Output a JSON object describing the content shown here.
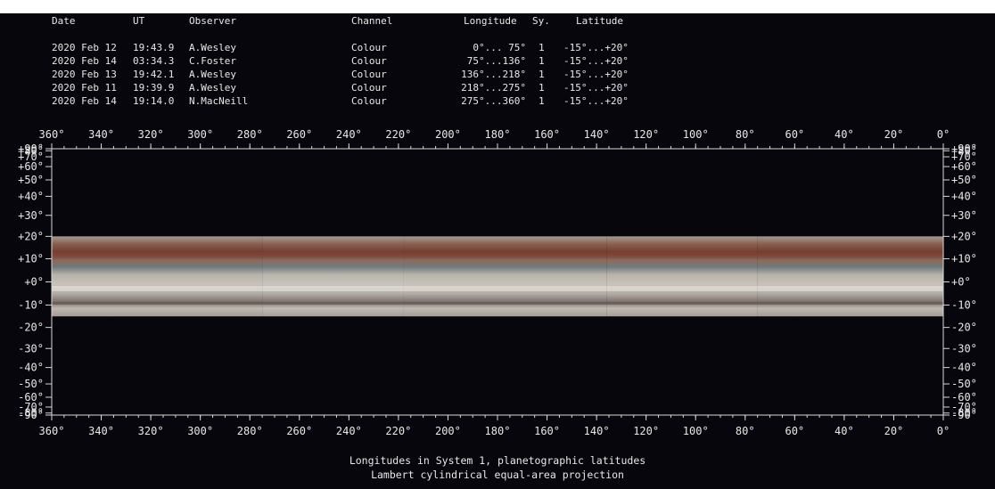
{
  "table": {
    "headers": {
      "date": "Date",
      "ut": "UT",
      "observer": "Observer",
      "channel": "Channel",
      "longitude": "Longitude",
      "system": "Sy.",
      "latitude": "Latitude"
    },
    "rows": [
      {
        "date": "2020 Feb 12",
        "ut": "19:43.9",
        "observer": "A.Wesley",
        "channel": "Colour",
        "longitude": "0°... 75°",
        "system": "1",
        "latitude": "-15°...+20°"
      },
      {
        "date": "2020 Feb 14",
        "ut": "03:34.3",
        "observer": "C.Foster",
        "channel": "Colour",
        "longitude": "75°...136°",
        "system": "1",
        "latitude": "-15°...+20°"
      },
      {
        "date": "2020 Feb 13",
        "ut": "19:42.1",
        "observer": "A.Wesley",
        "channel": "Colour",
        "longitude": "136°...218°",
        "system": "1",
        "latitude": "-15°...+20°"
      },
      {
        "date": "2020 Feb 11",
        "ut": "19:39.9",
        "observer": "A.Wesley",
        "channel": "Colour",
        "longitude": "218°...275°",
        "system": "1",
        "latitude": "-15°...+20°"
      },
      {
        "date": "2020 Feb 14",
        "ut": "19:14.0",
        "observer": "N.MacNeill",
        "channel": "Colour",
        "longitude": "275°...360°",
        "system": "1",
        "latitude": "-15°...+20°"
      }
    ]
  },
  "map": {
    "lon_range": [
      0,
      360
    ],
    "lat_range": [
      -90,
      90
    ],
    "lon_ticks": [
      "360°",
      "340°",
      "320°",
      "300°",
      "280°",
      "260°",
      "240°",
      "220°",
      "200°",
      "180°",
      "160°",
      "140°",
      "120°",
      "100°",
      "80°",
      "60°",
      "40°",
      "20°",
      "0°"
    ],
    "lat_ticks": [
      {
        "lat": 90,
        "label": "+90°"
      },
      {
        "lat": 80,
        "label": "+80°"
      },
      {
        "lat": 70,
        "label": "+70°"
      },
      {
        "lat": 60,
        "label": "+60°"
      },
      {
        "lat": 50,
        "label": "+50°"
      },
      {
        "lat": 40,
        "label": "+40°"
      },
      {
        "lat": 30,
        "label": "+30°"
      },
      {
        "lat": 20,
        "label": "+20°"
      },
      {
        "lat": 10,
        "label": "+10°"
      },
      {
        "lat": 0,
        "label": "+0°"
      },
      {
        "lat": -10,
        "label": "-10°"
      },
      {
        "lat": -20,
        "label": "-20°"
      },
      {
        "lat": -30,
        "label": "-30°"
      },
      {
        "lat": -40,
        "label": "-40°"
      },
      {
        "lat": -50,
        "label": "-50°"
      },
      {
        "lat": -60,
        "label": "-60°"
      },
      {
        "lat": -70,
        "label": "-70°"
      },
      {
        "lat": -80,
        "label": "-80°"
      },
      {
        "lat": -90,
        "label": "-90°"
      }
    ],
    "imaged_lat_range": [
      -15,
      20
    ],
    "strips": [
      {
        "lon_from": 275,
        "lon_to": 360
      },
      {
        "lon_from": 218,
        "lon_to": 275
      },
      {
        "lon_from": 136,
        "lon_to": 218
      },
      {
        "lon_from": 75,
        "lon_to": 136
      },
      {
        "lon_from": 0,
        "lon_to": 75
      }
    ],
    "colors": {
      "frame": "#d8d8d8",
      "background": "#000000",
      "belt": "#8a4a3a",
      "zone": "#c9c4bc"
    }
  },
  "caption": {
    "line1": "Longitudes in System 1, planetographic latitudes",
    "line2": "Lambert cylindrical equal-area projection"
  }
}
